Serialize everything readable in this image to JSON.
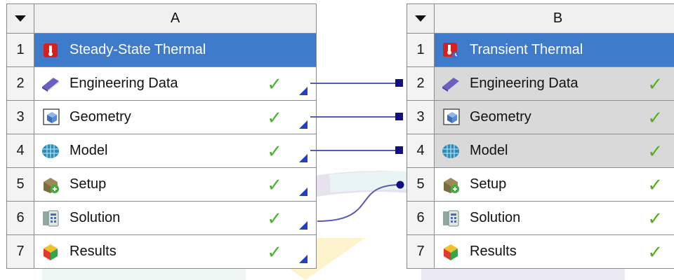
{
  "systems": [
    {
      "column": "A",
      "title": "Steady-State Thermal",
      "rows": [
        {
          "index": "2",
          "label": "Engineering Data",
          "icon": "engineering-data-icon",
          "status": "up-to-date"
        },
        {
          "index": "3",
          "label": "Geometry",
          "icon": "geometry-icon",
          "status": "up-to-date"
        },
        {
          "index": "4",
          "label": "Model",
          "icon": "model-icon",
          "status": "up-to-date"
        },
        {
          "index": "5",
          "label": "Setup",
          "icon": "setup-icon",
          "status": "up-to-date"
        },
        {
          "index": "6",
          "label": "Solution",
          "icon": "solution-icon",
          "status": "up-to-date"
        },
        {
          "index": "7",
          "label": "Results",
          "icon": "results-icon",
          "status": "up-to-date"
        }
      ]
    },
    {
      "column": "B",
      "title": "Transient Thermal",
      "rows": [
        {
          "index": "2",
          "label": "Engineering Data",
          "icon": "engineering-data-icon",
          "status": "up-to-date"
        },
        {
          "index": "3",
          "label": "Geometry",
          "icon": "geometry-icon",
          "status": "up-to-date"
        },
        {
          "index": "4",
          "label": "Model",
          "icon": "model-icon",
          "status": "up-to-date"
        },
        {
          "index": "5",
          "label": "Setup",
          "icon": "setup-icon",
          "status": "up-to-date"
        },
        {
          "index": "6",
          "label": "Solution",
          "icon": "solution-icon",
          "status": "up-to-date"
        },
        {
          "index": "7",
          "label": "Results",
          "icon": "results-icon",
          "status": "up-to-date"
        }
      ]
    }
  ],
  "title_index": "1",
  "colors": {
    "title_bar": "#3e7ccb",
    "check": "#4caf2e",
    "link": "#5a5ab4",
    "shared_cell": "#d9d9d9"
  }
}
